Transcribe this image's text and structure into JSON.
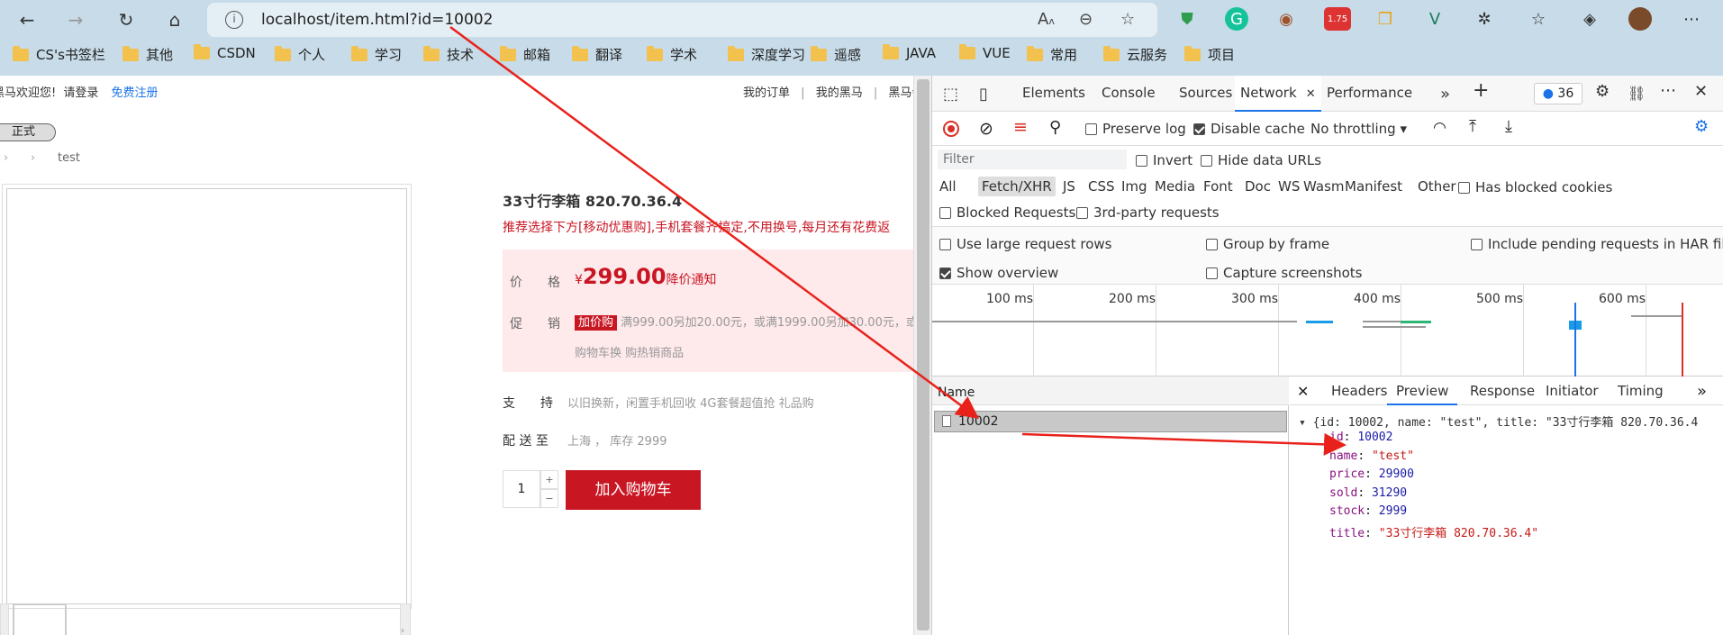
{
  "browser": {
    "url": "localhost/item.html?id=10002",
    "ext_badge": "1.75",
    "more_label": "⋯"
  },
  "bookmarks": [
    "CS's书签栏",
    "其他",
    "CSDN",
    "个人",
    "学习",
    "技术",
    "邮箱",
    "翻译",
    "学术",
    "深度学习",
    "遥感",
    "JAVA",
    "VUE",
    "常用",
    "云服务",
    "项目"
  ],
  "site": {
    "welcome": "黑马欢迎您!",
    "login": "请登录",
    "register": "免费注册",
    "top_links": [
      "我的订单",
      "我的黑马",
      "黑马会"
    ],
    "tag": "正式",
    "breadcrumb": "test",
    "product_title": "33寸行李箱 820.70.36.4",
    "promo_line": "推荐选择下方[移动优惠购],手机套餐齐搞定,不用换号,每月还有花费返",
    "price_label": "价　　格",
    "currency": "¥",
    "price": "299.00",
    "price_notice": "降价通知",
    "promo_label": "促　　销",
    "promo_badge": "加价购",
    "promo_text": "满999.00另加20.00元，或满1999.00另加30.00元，或",
    "promo_text2": "购物车换 购热销商品",
    "support_label": "支　　持",
    "support_text": "以旧换新，闲置手机回收 4G套餐超值抢 礼品购",
    "delivery_label": "配 送 至",
    "delivery_text": "上海 ， 库存 2999",
    "quantity": "1",
    "plus": "+",
    "minus": "−",
    "add_to_cart": "加入购物车"
  },
  "devtools": {
    "tabs": [
      "Elements",
      "Console",
      "Sources",
      "Network",
      "Performance"
    ],
    "active_tab": "Network",
    "issues_count": "36",
    "preserve_log": "Preserve log",
    "disable_cache": "Disable cache",
    "throttling": "No throttling",
    "filter_placeholder": "Filter",
    "invert": "Invert",
    "hide_data_urls": "Hide data URLs",
    "type_filters": [
      "All",
      "Fetch/XHR",
      "JS",
      "CSS",
      "Img",
      "Media",
      "Font",
      "Doc",
      "WS",
      "Wasm",
      "Manifest",
      "Other"
    ],
    "active_type": "Fetch/XHR",
    "has_blocked_cookies": "Has blocked cookies",
    "blocked_requests": "Blocked Requests",
    "third_party": "3rd-party requests",
    "large_rows": "Use large request rows",
    "group_by_frame": "Group by frame",
    "include_pending": "Include pending requests in HAR file",
    "show_overview": "Show overview",
    "capture_screenshots": "Capture screenshots",
    "timeline_ticks": [
      "100 ms",
      "200 ms",
      "300 ms",
      "400 ms",
      "500 ms",
      "600 ms"
    ],
    "name_header": "Name",
    "request_name": "10002",
    "detail_tabs": [
      "Headers",
      "Preview",
      "Response",
      "Initiator",
      "Timing"
    ],
    "active_detail": "Preview",
    "preview_summary": "{id: 10002, name: \"test\", title: \"33寸行李箱 820.70.36.4",
    "fields": [
      {
        "key": "id",
        "value": "10002",
        "type": "number"
      },
      {
        "key": "name",
        "value": "\"test\"",
        "type": "string"
      },
      {
        "key": "price",
        "value": "29900",
        "type": "number"
      },
      {
        "key": "sold",
        "value": "31290",
        "type": "number"
      },
      {
        "key": "stock",
        "value": "2999",
        "type": "number"
      },
      {
        "key": "title",
        "value": "\"33寸行李箱 820.70.36.4\"",
        "type": "string"
      }
    ]
  },
  "colors": {
    "accent": "#1a73e8",
    "brand_red": "#c81623",
    "annotation": "#e8221b",
    "string": "#c41a16",
    "number": "#1a1aa6"
  }
}
